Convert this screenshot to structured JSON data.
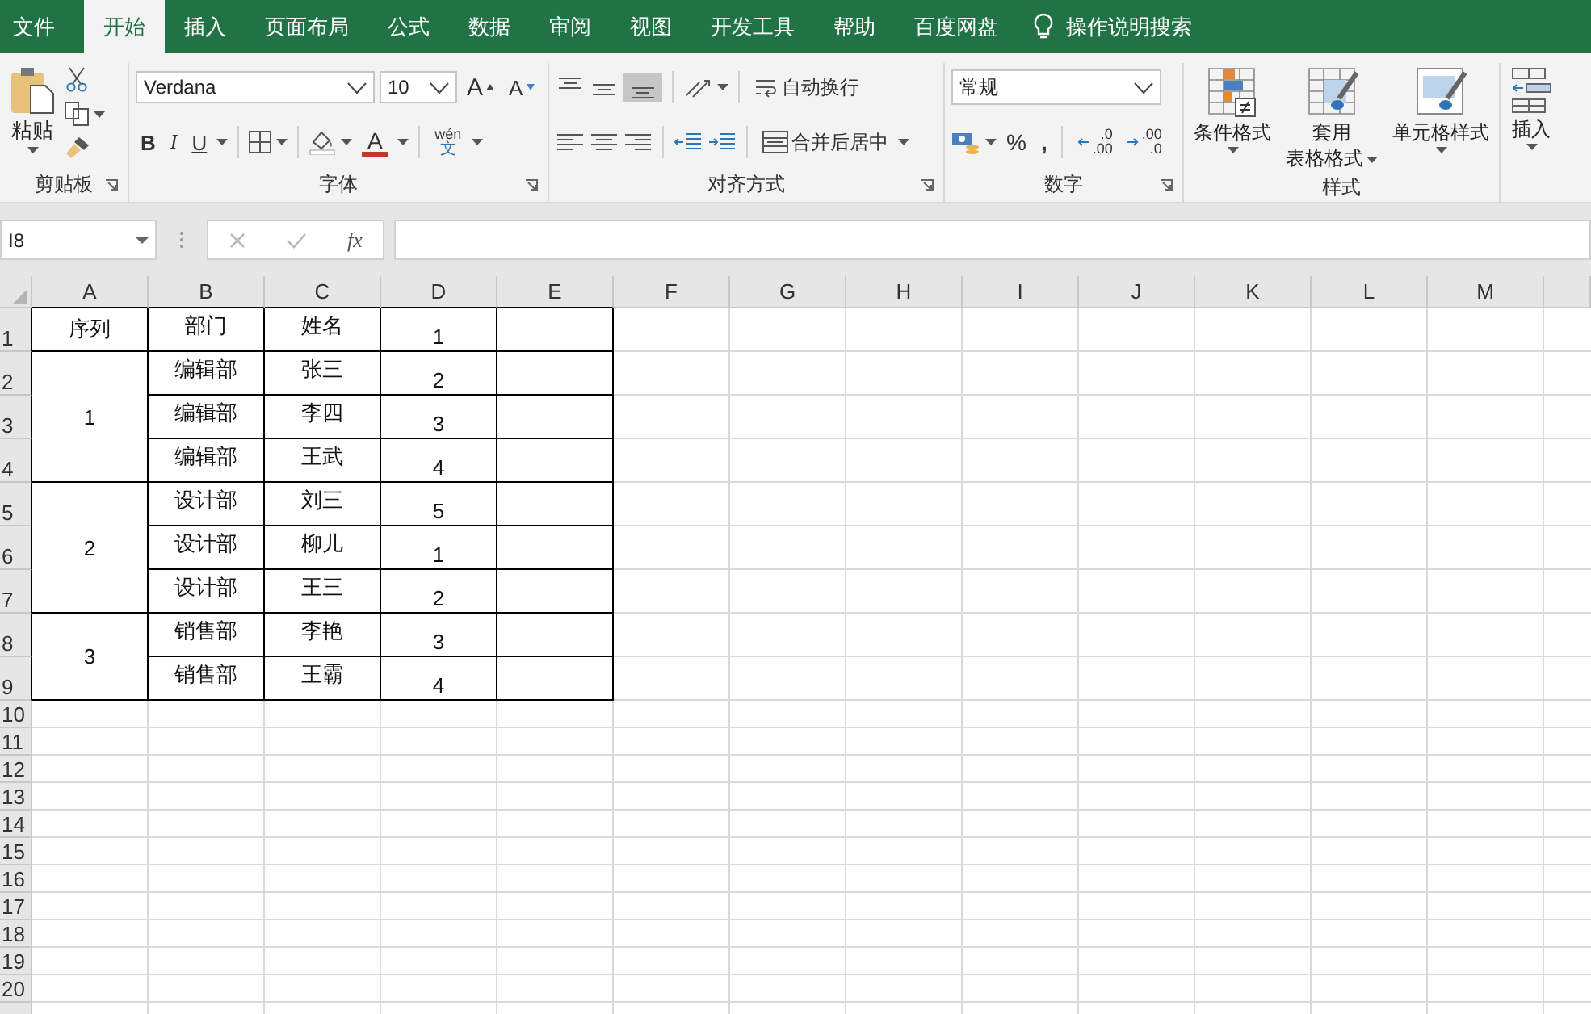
{
  "tabs": [
    {
      "label": "文件",
      "selected": false
    },
    {
      "label": "开始",
      "selected": true
    },
    {
      "label": "插入",
      "selected": false
    },
    {
      "label": "页面布局",
      "selected": false
    },
    {
      "label": "公式",
      "selected": false
    },
    {
      "label": "数据",
      "selected": false
    },
    {
      "label": "审阅",
      "selected": false
    },
    {
      "label": "视图",
      "selected": false
    },
    {
      "label": "开发工具",
      "selected": false
    },
    {
      "label": "帮助",
      "selected": false
    },
    {
      "label": "百度网盘",
      "selected": false
    }
  ],
  "tell_me": {
    "placeholder": "操作说明搜索"
  },
  "ribbon": {
    "clipboard": {
      "paste": "粘贴",
      "label": "剪贴板"
    },
    "font": {
      "font_name": "Verdana",
      "font_size": "10",
      "grow": "A",
      "shrink": "A",
      "bold": "B",
      "italic": "I",
      "underline": "U",
      "font_color": "A",
      "phonetic_top": "wén",
      "phonetic_bottom": "文",
      "label": "字体"
    },
    "alignment": {
      "wrap_text": "自动换行",
      "merge_center": "合并后居中",
      "label": "对齐方式"
    },
    "number": {
      "format": "常规",
      "percent": "%",
      "comma": ",",
      "increase_decimal": {
        "top": ".0",
        "bottom": ".00"
      },
      "decrease_decimal": {
        "top": ".00",
        "bottom": ".0"
      },
      "label": "数字"
    },
    "styles": {
      "conditional": "条件格式",
      "table_top": "套用",
      "table_bottom": "表格格式",
      "cell_styles": "单元格样式",
      "label": "样式"
    },
    "cells": {
      "insert": "插入"
    }
  },
  "formula_bar": {
    "name_box": "I8",
    "fx": "fx"
  },
  "sheet": {
    "column_headers": [
      "A",
      "B",
      "C",
      "D",
      "E",
      "F",
      "G",
      "H",
      "I",
      "J",
      "K",
      "L",
      "M"
    ],
    "row_headers": [
      "1",
      "2",
      "3",
      "4",
      "5",
      "6",
      "7",
      "8",
      "9",
      "10",
      "11",
      "12",
      "13",
      "14",
      "15",
      "16",
      "17",
      "18",
      "19",
      "20"
    ],
    "blocks": [
      {
        "a": "序列",
        "rows": [
          {
            "b": "部门",
            "c": "姓名",
            "d": "1"
          }
        ]
      },
      {
        "a": "1",
        "rows": [
          {
            "b": "编辑部",
            "c": "张三",
            "d": "2"
          },
          {
            "b": "编辑部",
            "c": "李四",
            "d": "3"
          },
          {
            "b": "编辑部",
            "c": "王武",
            "d": "4"
          }
        ]
      },
      {
        "a": "2",
        "rows": [
          {
            "b": "设计部",
            "c": "刘三",
            "d": "5"
          },
          {
            "b": "设计部",
            "c": "柳儿",
            "d": "1"
          },
          {
            "b": "设计部",
            "c": "王三",
            "d": "2"
          }
        ]
      },
      {
        "a": "3",
        "rows": [
          {
            "b": "销售部",
            "c": "李艳",
            "d": "3"
          },
          {
            "b": "销售部",
            "c": "王霸",
            "d": "4"
          }
        ]
      }
    ]
  }
}
